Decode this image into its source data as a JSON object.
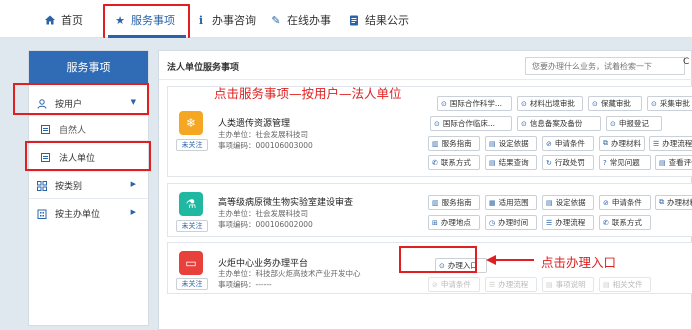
{
  "nav": {
    "home": "首页",
    "services": "服务事项",
    "consult": "办事咨询",
    "online": "在线办事",
    "results": "结果公示"
  },
  "sidebar": {
    "title": "服务事项",
    "by_user": "按用户",
    "natural_person": "自然人",
    "legal_entity": "法人单位",
    "by_category": "按类别",
    "by_dept": "按主办单位"
  },
  "main": {
    "breadcrumb": "法人单位服务事项",
    "search_placeholder": "您要办理什么业务，试着检索一下",
    "search_btn": "C"
  },
  "annotations": {
    "top": "点击服务事项—按用户—法人单位",
    "bottom": "点击办理入口"
  },
  "cards": [
    {
      "title": "人类遗传资源管理",
      "dept": "主办单位：社会发展科技司",
      "code": "事项编码：000106003000",
      "follow": "未关注",
      "tags": [
        "国际合作科学...",
        "材料出境审批",
        "保藏审批",
        "采集审批",
        "国际合作临床...",
        "信息备案及备份",
        "申报登记"
      ],
      "buttons": [
        "服务指南",
        "设定依据",
        "申请条件",
        "办理材料",
        "办理流程",
        "联系方式",
        "结果查询",
        "行政处罚",
        "常见问题",
        "查看评价"
      ]
    },
    {
      "title": "高等级病原微生物实验室建设审查",
      "dept": "主办单位：社会发展科技司",
      "code": "事项编码：000106002000",
      "follow": "未关注",
      "buttons": [
        "服务指南",
        "适用范围",
        "设定依据",
        "申请条件",
        "办理材料",
        "办理地点",
        "办理时间",
        "办理流程",
        "联系方式"
      ]
    },
    {
      "title": "火炬中心业务办理平台",
      "dept": "主办单位：科技部火炬高技术产业开发中心",
      "code": "事项编码：------",
      "follow": "未关注",
      "entry": "办理入口",
      "dim_buttons": [
        "申请条件",
        "办理流程",
        "事项说明",
        "相关文件"
      ]
    }
  ],
  "colors": {
    "accent": "#2b63a8",
    "sidebar_header": "#2f6cb5",
    "annotation": "#e02020",
    "card1_icon": "#f5a623",
    "card2_icon": "#20b8a0",
    "card3_icon": "#e8413c"
  }
}
